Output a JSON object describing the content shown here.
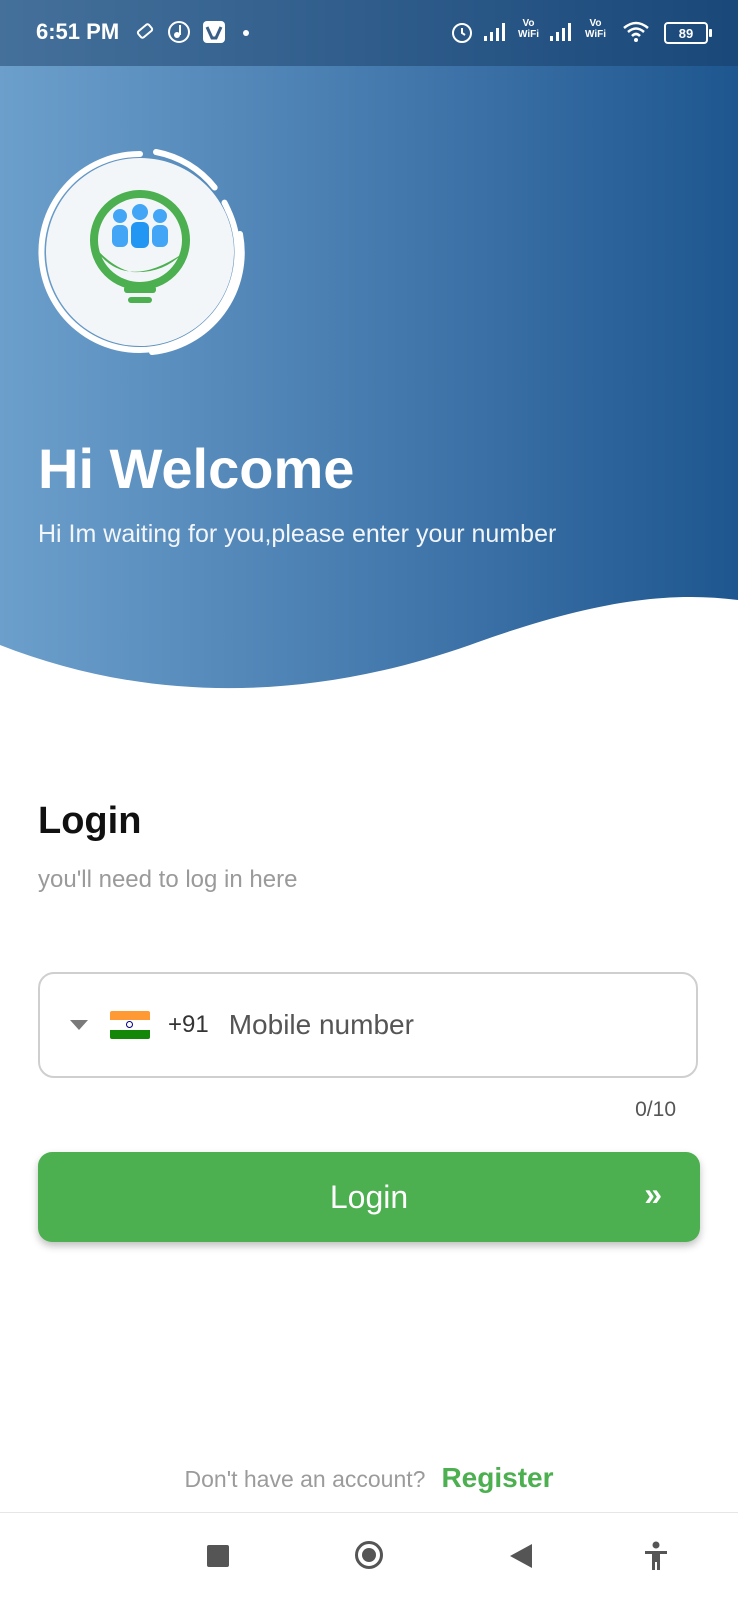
{
  "status_bar": {
    "time": "6:51 PM",
    "battery": "89",
    "icons": [
      "usb-icon",
      "music-icon",
      "vimeo-icon",
      "dot-icon",
      "alarm-icon",
      "signal-icon",
      "vowifi-icon",
      "signal-icon",
      "vowifi-icon",
      "wifi-icon",
      "battery-icon"
    ],
    "vowifi_top": "Vo",
    "vowifi_bottom": "WiFi"
  },
  "header": {
    "title": "Hi Welcome",
    "subtitle": "Hi Im waiting for you,please enter your number",
    "gradient_start": "#6c9fcb",
    "gradient_end": "#1e568f"
  },
  "login": {
    "title": "Login",
    "subtitle": "you'll need to log in here",
    "country_code": "+91",
    "phone_placeholder": "Mobile number",
    "phone_value": "",
    "counter": "0/10",
    "button_label": "Login",
    "button_icon": "double-chevron-right-icon",
    "accent": "#4caf50"
  },
  "footer": {
    "question": "Don't have an account?",
    "register_label": "Register"
  },
  "nav": {
    "icons": [
      "recents-icon",
      "home-icon",
      "back-icon",
      "accessibility-icon"
    ]
  }
}
